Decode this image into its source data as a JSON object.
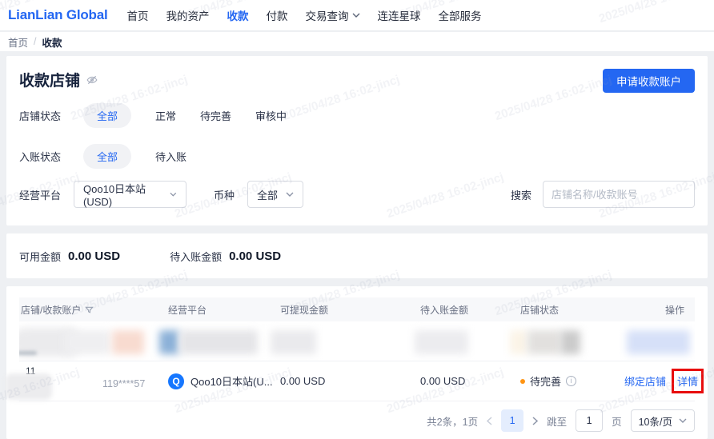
{
  "nav": {
    "logo": "LianLian Global",
    "items": [
      {
        "label": "首页"
      },
      {
        "label": "我的资产"
      },
      {
        "label": "收款"
      },
      {
        "label": "付款"
      },
      {
        "label": "交易查询"
      },
      {
        "label": "连连星球"
      },
      {
        "label": "全部服务"
      }
    ]
  },
  "breadcrumb": {
    "home": "首页",
    "separator": "/",
    "current": "收款"
  },
  "page": {
    "title": "收款店铺",
    "apply_button": "申请收款账户"
  },
  "filters": {
    "shop_status": {
      "label": "店铺状态",
      "options": [
        "全部",
        "正常",
        "待完善",
        "审核中"
      ],
      "selected": "全部"
    },
    "entry_status": {
      "label": "入账状态",
      "options": [
        "全部",
        "待入账"
      ],
      "selected": "全部"
    },
    "platform": {
      "label": "经营平台",
      "value": "Qoo10日本站(USD)"
    },
    "currency": {
      "label": "币种",
      "value": "全部"
    },
    "search": {
      "label": "搜索",
      "placeholder": "店铺名称/收款账号",
      "value": ""
    }
  },
  "summary": {
    "available_label": "可用金额",
    "available_value": "0.00 USD",
    "pending_label": "待入账金额",
    "pending_value": "0.00 USD"
  },
  "table": {
    "headers": [
      "店铺/收款账户",
      "经营平台",
      "可提现金额",
      "待入账金额",
      "店铺状态",
      "操作"
    ],
    "rows": {
      "0": {
        "redacted": true
      },
      "1": {
        "shop_id": "11",
        "account": "119****57",
        "platform_icon": "Q",
        "platform": "Qoo10日本站(U...",
        "withdrawable": "0.00 USD",
        "pending": "0.00 USD",
        "status": "待完善",
        "action_bind": "绑定店铺",
        "action_detail": "详情"
      }
    }
  },
  "pagination": {
    "total_text": "共2条，1页",
    "current_page": "1",
    "jump_label": "跳至",
    "jump_value": "1",
    "page_unit": "页",
    "page_size": "10条/页"
  },
  "watermark": {
    "text": "2025/04/28 16:02-jincj"
  },
  "colors": {
    "primary": "#2467f2",
    "status_orange": "#ff9412",
    "highlight_red": "#e80e0e"
  }
}
